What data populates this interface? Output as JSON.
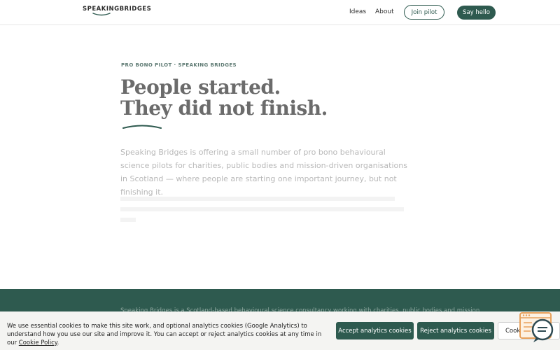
{
  "header": {
    "logo_text": "SPEAKINGBRIDGES",
    "nav": {
      "ideas": "Ideas",
      "about": "About"
    },
    "join_label": "Join pilot",
    "hello_label": "Say hello"
  },
  "hero": {
    "eyebrow": "PRO BONO PILOT · SPEAKING BRIDGES",
    "headline_line1": "People started.",
    "headline_line2": "They did not finish.",
    "lead": "Speaking Bridges is offering a small number of pro bono behavioural science pilots for charities, public bodies and mission-driven organisations in Scotland — where people are starting one important journey, but not finishing it."
  },
  "band": {
    "text": "Speaking Bridges is a Scotland-based behavioural science consultancy working with charities, public bodies and mission"
  },
  "cookie": {
    "text_before_link": "We use essential cookies to make this site work, and optional analytics cookies (Google Analytics) to understand how you use our site and improve it. You can accept or reject analytics cookies at any time in our ",
    "link_text": "Cookie Policy",
    "text_after_link": ".",
    "accept_label": "Accept analytics cookies",
    "reject_label": "Reject analytics cookies",
    "settings_label": "Cookie settings"
  },
  "colors": {
    "brand_green": "#2e5a4f",
    "widget_orange": "#e8a15c",
    "headline_gray": "#6b6b6b"
  },
  "icons": {
    "widget": "chat-support-icon"
  }
}
